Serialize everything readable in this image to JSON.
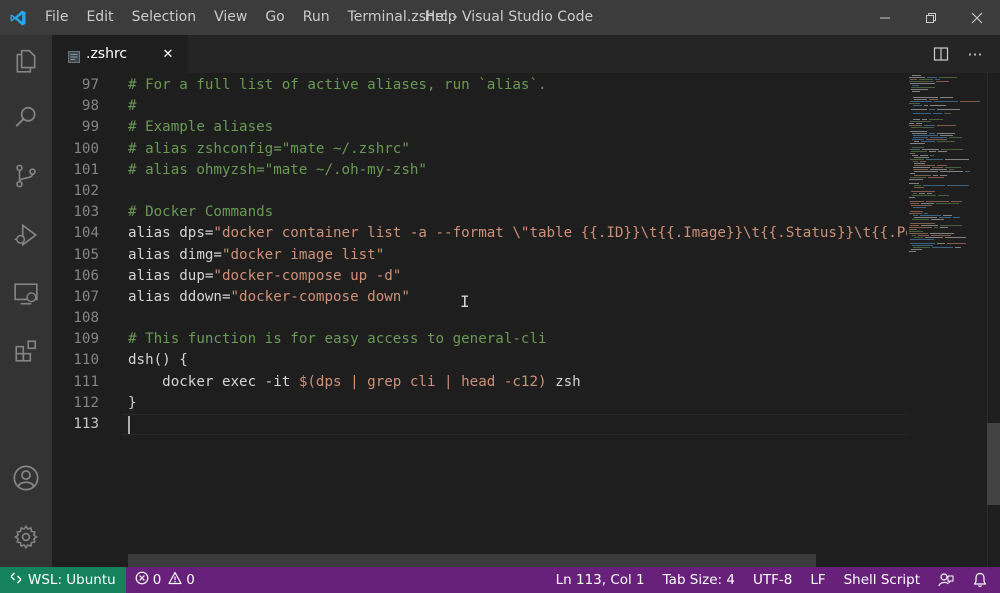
{
  "window": {
    "title": ".zshrc - Visual Studio Code",
    "menu": [
      "File",
      "Edit",
      "Selection",
      "View",
      "Go",
      "Run",
      "Terminal",
      "Help"
    ],
    "controls": [
      "minimize-icon",
      "restore-icon",
      "close-icon"
    ]
  },
  "activity_bar": {
    "items": [
      "explorer-icon",
      "search-icon",
      "source-control-icon",
      "run-debug-icon",
      "remote-explorer-icon",
      "extensions-icon"
    ],
    "bottom": [
      "accounts-icon",
      "settings-gear-icon"
    ]
  },
  "tab": {
    "label": ".zshrc",
    "close_glyph": "✕",
    "actions": [
      "split-editor-icon",
      "more-actions-icon"
    ],
    "more_glyph": "···"
  },
  "editor": {
    "lines": [
      {
        "n": "97",
        "tokens": [
          {
            "t": "# For a full list of active aliases, run `alias`.",
            "c": "comment"
          }
        ]
      },
      {
        "n": "98",
        "tokens": [
          {
            "t": "#",
            "c": "comment"
          }
        ]
      },
      {
        "n": "99",
        "tokens": [
          {
            "t": "# Example aliases",
            "c": "comment"
          }
        ]
      },
      {
        "n": "100",
        "tokens": [
          {
            "t": "# alias zshconfig=\"mate ~/.zshrc\"",
            "c": "comment"
          }
        ]
      },
      {
        "n": "101",
        "tokens": [
          {
            "t": "# alias ohmyzsh=\"mate ~/.oh-my-zsh\"",
            "c": "comment"
          }
        ]
      },
      {
        "n": "102",
        "tokens": []
      },
      {
        "n": "103",
        "tokens": [
          {
            "t": "# Docker Commands",
            "c": "comment"
          }
        ]
      },
      {
        "n": "104",
        "tokens": [
          {
            "t": "alias dps=",
            "c": "plain"
          },
          {
            "t": "\"docker container list -a --format \\\"table {{.ID}}\\t{{.Image}}\\t{{.Status}}\\t{{.Po",
            "c": "string"
          }
        ]
      },
      {
        "n": "105",
        "tokens": [
          {
            "t": "alias dimg=",
            "c": "plain"
          },
          {
            "t": "\"docker image list\"",
            "c": "string"
          }
        ]
      },
      {
        "n": "106",
        "tokens": [
          {
            "t": "alias dup=",
            "c": "plain"
          },
          {
            "t": "\"docker-compose up -d\"",
            "c": "string"
          }
        ]
      },
      {
        "n": "107",
        "tokens": [
          {
            "t": "alias ddown=",
            "c": "plain"
          },
          {
            "t": "\"docker-compose down\"",
            "c": "string"
          }
        ]
      },
      {
        "n": "108",
        "tokens": []
      },
      {
        "n": "109",
        "tokens": [
          {
            "t": "# This function is for easy access to general-cli",
            "c": "comment"
          }
        ]
      },
      {
        "n": "110",
        "tokens": [
          {
            "t": "dsh() {",
            "c": "plain"
          }
        ]
      },
      {
        "n": "111",
        "tokens": [
          {
            "t": "    docker exec -it ",
            "c": "plain"
          },
          {
            "t": "$(dps | grep cli | head -c12)",
            "c": "string"
          },
          {
            "t": " zsh",
            "c": "plain"
          }
        ]
      },
      {
        "n": "112",
        "tokens": [
          {
            "t": "}",
            "c": "plain"
          }
        ]
      },
      {
        "n": "113",
        "tokens": [],
        "current": true
      }
    ],
    "mouse_cursor_glyph": "I"
  },
  "status_bar": {
    "remote": "WSL: Ubuntu",
    "errors": "0",
    "warnings": "0",
    "position": "Ln 113, Col 1",
    "tab_size": "Tab Size: 4",
    "encoding": "UTF-8",
    "eol": "LF",
    "language": "Shell Script",
    "extra": [
      "feedback-icon",
      "notifications-bell-icon"
    ]
  },
  "colors": {
    "title_bar": "#3c3c3c",
    "activity_bar": "#333333",
    "editor_bg": "#1e1e1e",
    "status_bar": "#68217a",
    "remote_indicator": "#16825d",
    "comment": "#6a9955",
    "string": "#ce9178",
    "text": "#d4d4d4"
  }
}
